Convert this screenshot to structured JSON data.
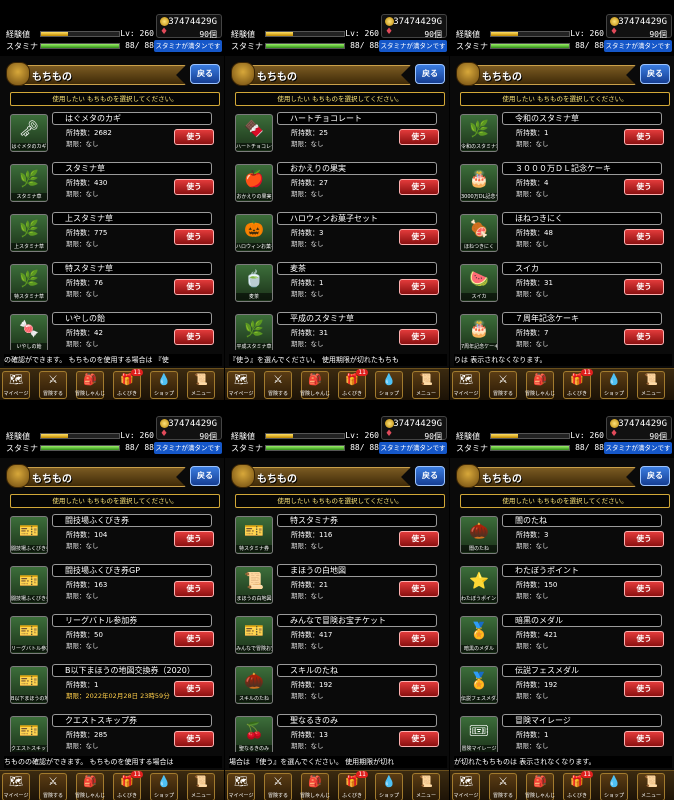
{
  "status": {
    "exp_label": "経験値",
    "stamina_label": "スタミナ",
    "level": "Lv: 260",
    "stamina_value": "88/ 88",
    "exp_fill": 0.35,
    "stamina_fill": 1.0,
    "gold": "37474429G",
    "gems": "90個",
    "recover_label": "スタミナが満タンです"
  },
  "header": {
    "title": "もちもの",
    "back_label": "戻る",
    "prompt": "使用したい もちものを選択してください。"
  },
  "use_label": "使う",
  "menu": [
    {
      "label": "マイページ",
      "icon": "map-icon",
      "glyph": "🗺"
    },
    {
      "label": "冒険する",
      "icon": "sword-icon",
      "glyph": "⚔"
    },
    {
      "label": "冒険しゃんじ",
      "icon": "bag-icon",
      "glyph": "🎒"
    },
    {
      "label": "ふくびき",
      "icon": "lottery-icon",
      "glyph": "🎁",
      "badge": "11"
    },
    {
      "label": "ショップ",
      "icon": "slime-icon",
      "glyph": "💧"
    },
    {
      "label": "メニュー",
      "icon": "scroll-icon",
      "glyph": "📜"
    }
  ],
  "panels": [
    {
      "ticker": "の確認ができます。 もちものを使用する場合は 『使",
      "items": [
        {
          "name": "はぐメタのカギ",
          "qty": "所持数：2682",
          "expiry": "期限：なし",
          "cap": "はぐメタのカギ",
          "glyph": "🗝"
        },
        {
          "name": "スタミナ草",
          "qty": "所持数：430",
          "expiry": "期限：なし",
          "cap": "スタミナ草",
          "glyph": "🌿"
        },
        {
          "name": "上スタミナ草",
          "qty": "所持数：775",
          "expiry": "期限：なし",
          "cap": "上スタミナ草",
          "glyph": "🌿"
        },
        {
          "name": "特スタミナ草",
          "qty": "所持数：76",
          "expiry": "期限：なし",
          "cap": "特スタミナ草",
          "glyph": "🌿"
        },
        {
          "name": "いやしの飴",
          "qty": "所持数：42",
          "expiry": "期限：なし",
          "cap": "いやしの飴",
          "glyph": "🍬"
        }
      ]
    },
    {
      "ticker": "『使う』を選んでください。 使用期限が切れたもちも",
      "items": [
        {
          "name": "ハートチョコレート",
          "qty": "所持数：25",
          "expiry": "期限：なし",
          "cap": "ハートチョコレート",
          "glyph": "🍫"
        },
        {
          "name": "おかえりの果実",
          "qty": "所持数：27",
          "expiry": "期限：なし",
          "cap": "おかえりの果実",
          "glyph": "🍎"
        },
        {
          "name": "ハロウィンお菓子セット",
          "qty": "所持数：3",
          "expiry": "期限：なし",
          "cap": "ハロウィンお菓子セット",
          "glyph": "🎃"
        },
        {
          "name": "麦茶",
          "qty": "所持数：1",
          "expiry": "期限：なし",
          "cap": "麦茶",
          "glyph": "🍵"
        },
        {
          "name": "平成のスタミナ草",
          "qty": "所持数：31",
          "expiry": "期限：なし",
          "cap": "平成スタミナ草",
          "glyph": "🌿"
        }
      ]
    },
    {
      "ticker": "りは 表示されなくなります。",
      "top_partial": "令和のスタミナ草",
      "items": [
        {
          "name": "令和のスタミナ草",
          "qty": "所持数：1",
          "expiry": "期限：なし",
          "cap": "令和のスタミナ草",
          "glyph": "🌿"
        },
        {
          "name": "３０００万ＤＬ記念ケーキ",
          "qty": "所持数：4",
          "expiry": "期限：なし",
          "cap": "3000万DL記念ケーキ",
          "glyph": "🎂"
        },
        {
          "name": "ほねつきにく",
          "qty": "所持数：48",
          "expiry": "期限：なし",
          "cap": "ほねつきにく",
          "glyph": "🍖"
        },
        {
          "name": "スイカ",
          "qty": "所持数：31",
          "expiry": "期限：なし",
          "cap": "スイカ",
          "glyph": "🍉"
        },
        {
          "name": "７周年記念ケーキ",
          "qty": "所持数：7",
          "expiry": "期限：なし",
          "cap": "7周年記念ケーキ",
          "glyph": "🎂"
        }
      ]
    },
    {
      "ticker": "ちものの確認ができます。 もちものを使用する場合は",
      "items": [
        {
          "name": "闘技場ふくびき券",
          "qty": "所持数：104",
          "expiry": "期限：なし",
          "cap": "闘技場ふくびき券",
          "glyph": "🎫"
        },
        {
          "name": "闘技場ふくびき券GP",
          "qty": "所持数：163",
          "expiry": "期限：なし",
          "cap": "闘技場ふくびき券GP",
          "glyph": "🎫"
        },
        {
          "name": "リーグバトル参加券",
          "qty": "所持数：50",
          "expiry": "期限：なし",
          "cap": "リーグバトル参加券",
          "glyph": "🎫"
        },
        {
          "name": "B以下まほうの地図交換券（2020）",
          "qty": "所持数：1",
          "expiry": "期限：2022年02月28日 23時59分",
          "dated": true,
          "cap": "B以下まほうの地図交換券",
          "glyph": "🎫"
        },
        {
          "name": "クエストスキップ券",
          "qty": "所持数：285",
          "expiry": "期限：なし",
          "cap": "クエストスキップ券",
          "glyph": "🎫"
        }
      ]
    },
    {
      "ticker": "場合は 『使う』を選んでください。 使用期限が切れ",
      "items": [
        {
          "name": "特スタミナ券",
          "qty": "所持数：116",
          "expiry": "期限：なし",
          "cap": "特スタミナ券",
          "glyph": "🎫"
        },
        {
          "name": "まほうの白地図",
          "qty": "所持数：21",
          "expiry": "期限：なし",
          "cap": "まほうの白地図",
          "glyph": "📜"
        },
        {
          "name": "みんなで冒険お宝チケット",
          "qty": "所持数：417",
          "expiry": "期限：なし",
          "cap": "みんなで冒険お宝チケット",
          "glyph": "🎫"
        },
        {
          "name": "スキルのたね",
          "qty": "所持数：192",
          "expiry": "期限：なし",
          "cap": "スキルのたね",
          "glyph": "🌰"
        },
        {
          "name": "聖なるきのみ",
          "qty": "所持数：13",
          "expiry": "期限：なし",
          "cap": "聖なるきのみ",
          "glyph": "🍒"
        }
      ]
    },
    {
      "ticker": "が切れたもちものは 表示されなくなります。",
      "items": [
        {
          "name": "闇のたね",
          "qty": "所持数：3",
          "expiry": "期限：なし",
          "cap": "闇のたね",
          "glyph": "🌰"
        },
        {
          "name": "わたぼうポイント",
          "qty": "所持数：150",
          "expiry": "期限：なし",
          "cap": "わたぼうポイント",
          "glyph": "⭐"
        },
        {
          "name": "暗黒のメダル",
          "qty": "所持数：421",
          "expiry": "期限：なし",
          "cap": "暗黒のメダル",
          "glyph": "🏅"
        },
        {
          "name": "伝説フェスメダル",
          "qty": "所持数：192",
          "expiry": "期限：なし",
          "cap": "伝説フェスメダル",
          "glyph": "🏅"
        },
        {
          "name": "冒険マイレージ",
          "qty": "所持数：1",
          "expiry": "期限：なし",
          "cap": "冒険マイレージ",
          "glyph": "🎟"
        }
      ]
    }
  ]
}
